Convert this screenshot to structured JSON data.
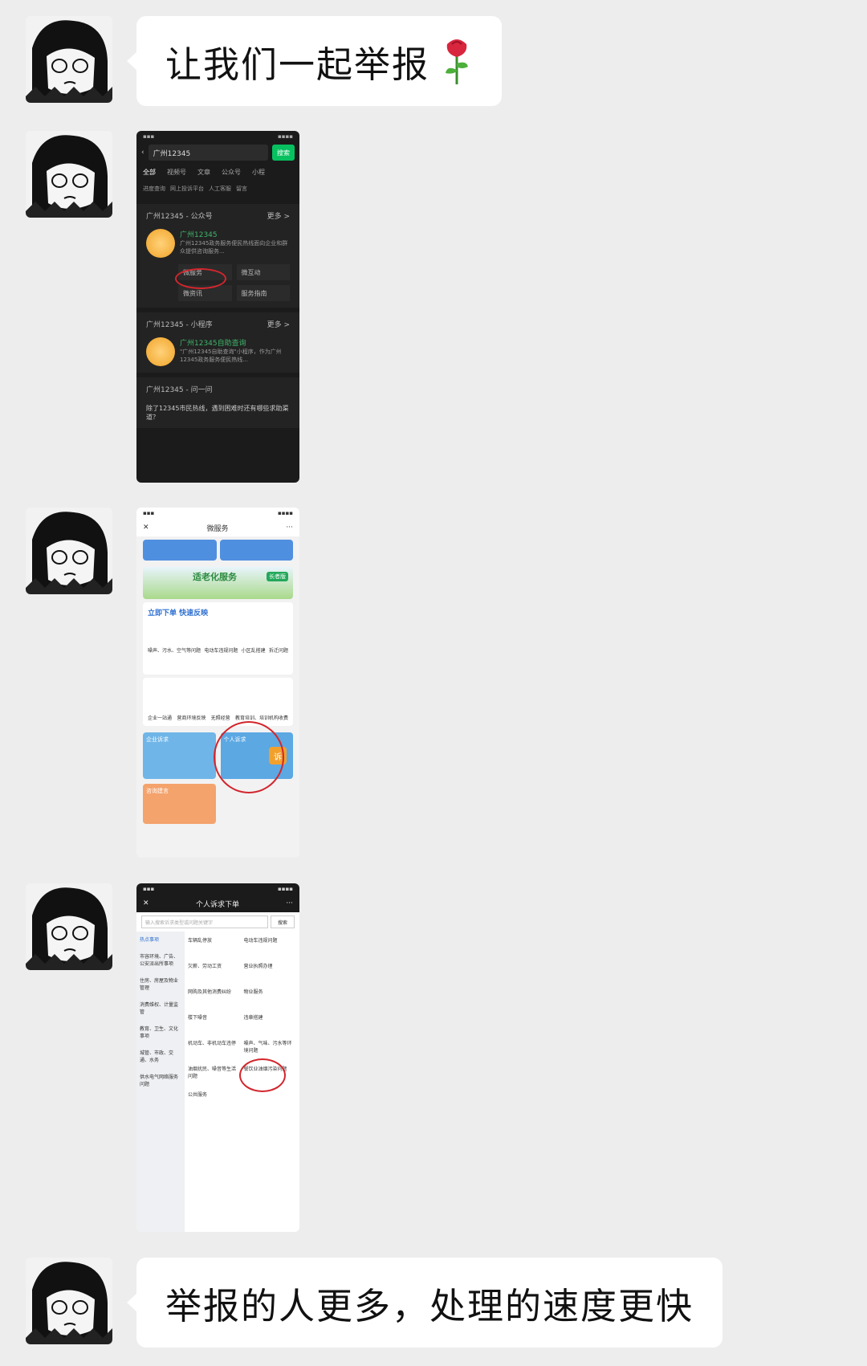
{
  "messages": [
    {
      "text": "让我们一起举报"
    },
    {
      "text": "举报的人更多，处理的速度更快"
    }
  ],
  "shot1": {
    "search": "广州12345",
    "search_button": "搜索",
    "tabs": [
      "全部",
      "视频号",
      "文章",
      "公众号",
      "小程"
    ],
    "chips": [
      "进度查询",
      "网上投诉平台",
      "人工客服",
      "留言"
    ],
    "section1_title": "广州12345 - 公众号",
    "section1_more": "更多 >",
    "account_name": "广州12345",
    "account_desc": "广州12345政务服务便民热线面向企业和群众提供咨询服务...",
    "account_buttons": [
      "微服务",
      "微互动",
      "微资讯",
      "服务指南"
    ],
    "section2_title": "广州12345 - 小程序",
    "section2_more": "更多 >",
    "mini_name": "广州12345自助查询",
    "mini_desc": "\"广州12345自助查询\"小程序，作为广州12345政务服务便民热线...",
    "section3_title": "广州12345 - 问一问",
    "section3_text": "除了12345市民热线，遇到困难时还有哪些求助渠道？"
  },
  "shot2": {
    "title": "微服务",
    "banner": "适老化服务",
    "banner_tag": "长者版",
    "section_title": "立即下单 快速反映",
    "items": [
      "噪声、污水、空气等问题",
      "电动车违规问题",
      "小区乱搭建",
      "拆迁问题"
    ],
    "items2": [
      "企业一站通",
      "营商环境反映",
      "无照经营",
      "教育培训、培训机构收费"
    ],
    "tiles": [
      "企业诉求",
      "个人诉求",
      "咨询建言"
    ],
    "tile_icon": "诉"
  },
  "shot3": {
    "title": "个人诉求下单",
    "search_placeholder": "输入搜索诉求类型或问题关键字",
    "search_button": "搜索",
    "left_menu": [
      "热点事项",
      "市容环境、广告、公安派出所事项",
      "住房、房屋及物业管理",
      "消费维权、计量监管",
      "教育、卫生、文化事项",
      "城管、市政、交通、水务",
      "供水电气网络服务问题"
    ],
    "right_items": [
      "车辆乱停放",
      "电动车违规问题",
      "欠薪、劳动工资",
      "营业执照办理",
      "网购及其他消费纠纷",
      "物业服务",
      "楼下噪音",
      "违章搭建",
      "机动车、非机动车违停",
      "噪声、气味、污水等环境问题",
      "油烟扰民、噪音等生活问题",
      "餐饮业油烟污染问题",
      "公共服务"
    ]
  }
}
